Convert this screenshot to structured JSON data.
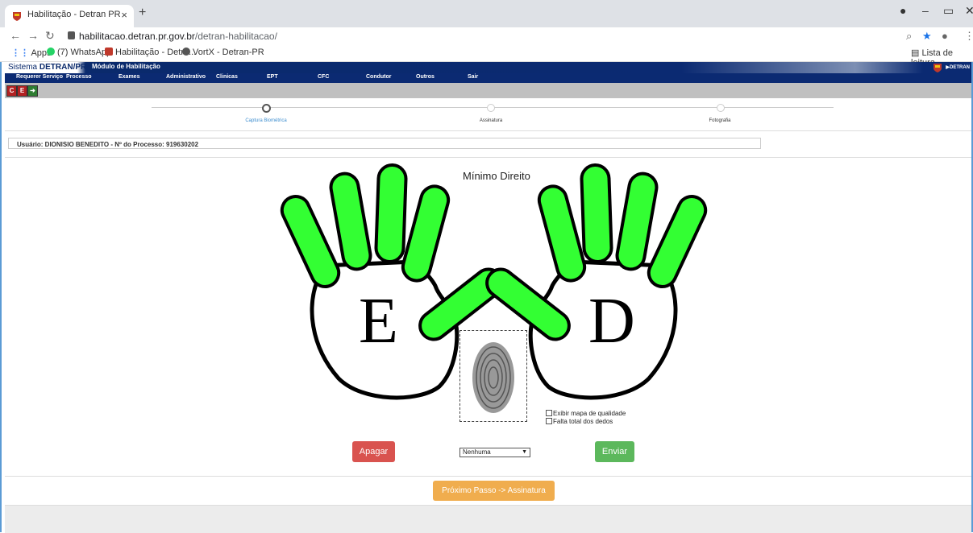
{
  "browser": {
    "tab_title": "Habilitação - Detran PR",
    "tab_close": "×",
    "new_tab": "+",
    "url_host": "habilitacao.detran.pr.gov.br",
    "url_path": "/detran-habilitacao/",
    "bookmarks": [
      "Apps",
      "(7) WhatsApp",
      "Habilitação - Detra...",
      "VortX - Detran-PR"
    ],
    "reading_list": "Lista de leitura"
  },
  "app": {
    "system_prefix": "Sistema ",
    "system_name": "DETRAN/PR",
    "module": "Módulo de Habilitação",
    "brand": "DETRAN",
    "menu": [
      "Requerer Serviço",
      "Processo",
      "Exames",
      "Administrativo",
      "Clinicas",
      "EPT",
      "CFC",
      "Condutor",
      "Outros",
      "Sair"
    ]
  },
  "steps": [
    {
      "label": "Captura Biométrica",
      "active": true
    },
    {
      "label": "Assinatura",
      "active": false
    },
    {
      "label": "Fotografia",
      "active": false
    }
  ],
  "user_info": "Usuário: DIONISIO BENEDITO - Nº do Processo: 919630202",
  "capture": {
    "finger_title": "Mínimo Direito",
    "left_hand_letter": "E",
    "right_hand_letter": "D",
    "option_quality_map": "Exibir mapa de qualidade",
    "option_missing_finger": "Falta total dos dedos",
    "finger_color": "#33ff33"
  },
  "actions": {
    "clear": "Apagar",
    "select_value": "Nenhuma",
    "send": "Enviar",
    "next": "Próximo Passo -> Assinatura"
  }
}
